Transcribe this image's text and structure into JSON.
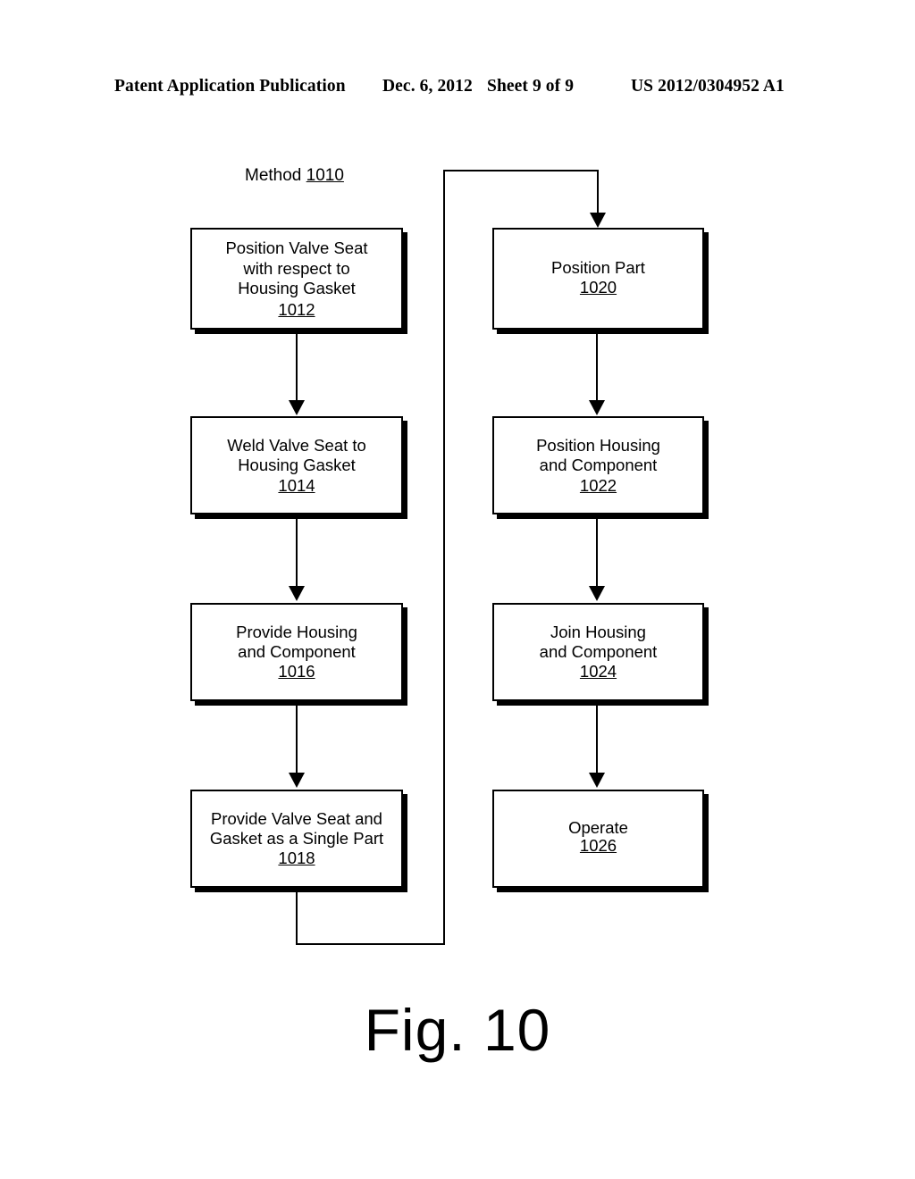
{
  "header": {
    "publication": "Patent Application Publication",
    "date": "Dec. 6, 2012",
    "sheet": "Sheet 9 of 9",
    "number": "US 2012/0304952 A1"
  },
  "figure": {
    "caption": "Fig. 10",
    "method_label": "Method",
    "method_ref": "1010"
  },
  "flowchart": {
    "left_column": [
      {
        "id": "1012",
        "text": "Position Valve Seat\nwith respect to\nHousing Gasket",
        "ref": "1012"
      },
      {
        "id": "1014",
        "text": "Weld Valve Seat to\nHousing Gasket",
        "ref": "1014"
      },
      {
        "id": "1016",
        "text": "Provide Housing\nand Component",
        "ref": "1016"
      },
      {
        "id": "1018",
        "text": "Provide Valve Seat and\nGasket as a Single Part",
        "ref": "1018"
      }
    ],
    "right_column": [
      {
        "id": "1020",
        "text": "Position Part",
        "ref": "1020"
      },
      {
        "id": "1022",
        "text": "Position Housing\nand Component",
        "ref": "1022"
      },
      {
        "id": "1024",
        "text": "Join Housing\nand Component",
        "ref": "1024"
      },
      {
        "id": "1026",
        "text": "Operate",
        "ref": "1026"
      }
    ],
    "colors": {
      "stroke": "#000000",
      "fill": "#ffffff",
      "shadow": "#000000"
    }
  }
}
